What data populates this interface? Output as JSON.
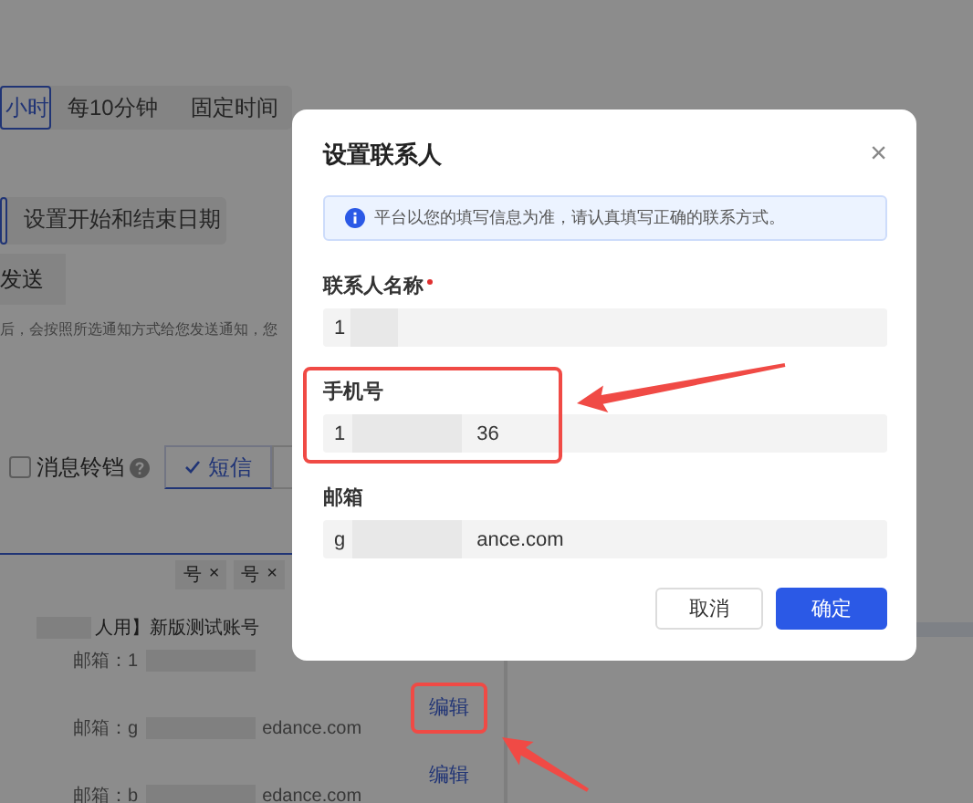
{
  "background": {
    "frequency_tabs": [
      {
        "label": "小时",
        "selected": true
      },
      {
        "label": "每10分钟",
        "selected": false
      },
      {
        "label": "固定时间",
        "selected": false
      }
    ],
    "date_tabs": [
      {
        "label": "设置开始和结束日期",
        "selected": false
      }
    ],
    "send_button": "发送",
    "description": "后，会按照所选通知方式给您发送通知，您",
    "bell_checkbox": {
      "label": "消息铃铛",
      "checked": false
    },
    "channel_buttons": [
      {
        "label": "短信",
        "checked": true
      }
    ],
    "tags": [
      {
        "label": "号",
        "remove": "×"
      },
      {
        "label": "号",
        "remove": "×"
      }
    ],
    "contact_title": "人用】新版测试账号",
    "contacts": [
      {
        "email_parts": [
          "邮箱：1"
        ]
      },
      {
        "email_parts": [
          "邮箱：g",
          "edance.com"
        ],
        "action": "编辑"
      },
      {
        "email_parts": [
          "邮箱：b",
          "edance.com"
        ],
        "action": "编辑"
      }
    ]
  },
  "dialog": {
    "title": "设置联系人",
    "close": "×",
    "notice": "平台以您的填写信息为准，请认真填写正确的联系方式。",
    "fields": [
      {
        "label": "联系人名称",
        "required": true,
        "value_parts": [
          "1"
        ]
      },
      {
        "label": "手机号",
        "required": false,
        "value_parts": [
          "1",
          "36"
        ]
      },
      {
        "label": "邮箱",
        "required": false,
        "value_parts": [
          "g",
          "ance.com"
        ]
      }
    ],
    "buttons": [
      {
        "label": "取消",
        "kind": "secondary"
      },
      {
        "label": "确定",
        "kind": "primary"
      }
    ]
  }
}
